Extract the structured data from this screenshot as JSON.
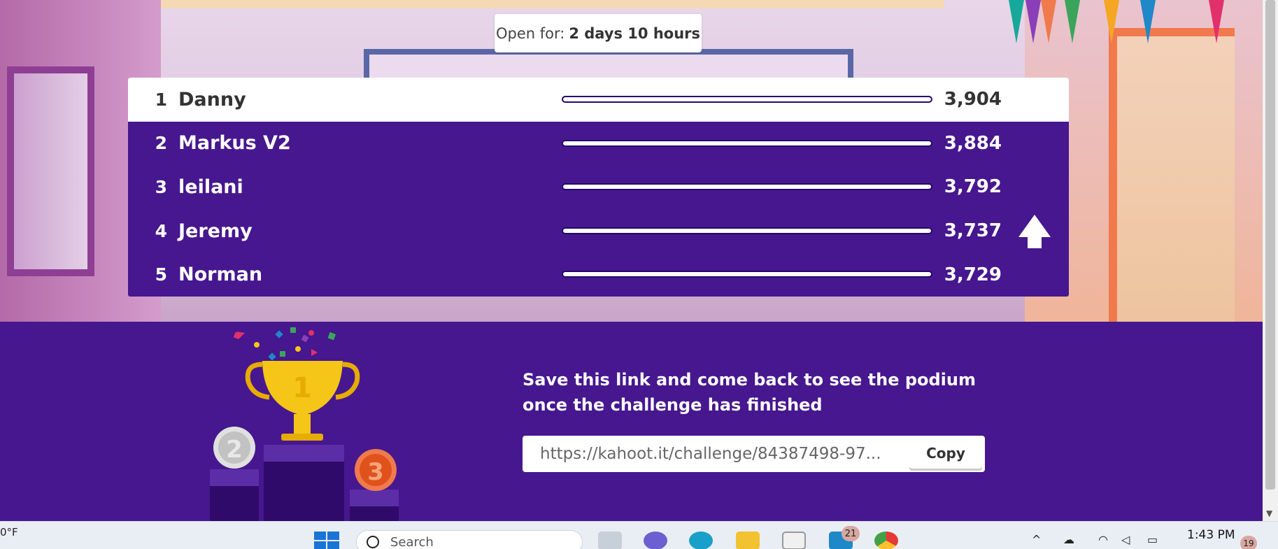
{
  "timer": {
    "label": "Open for:",
    "value": "2 days 10 hours"
  },
  "leaderboard": [
    {
      "rank": "1",
      "name": "Danny",
      "score": "3,904"
    },
    {
      "rank": "2",
      "name": "Markus V2",
      "score": "3,884"
    },
    {
      "rank": "3",
      "name": "leilani",
      "score": "3,792"
    },
    {
      "rank": "4",
      "name": "Jeremy",
      "score": "3,737"
    },
    {
      "rank": "5",
      "name": "Norman",
      "score": "3,729"
    }
  ],
  "share": {
    "message": "Save this link and come back to see the podium once the challenge has finished",
    "link": "https://kahoot.it/challenge/84387498-97...",
    "copy_label": "Copy"
  },
  "podium": {
    "first": "1",
    "second": "2",
    "third": "3"
  },
  "taskbar": {
    "weather": "0°F",
    "search_placeholder": "Search",
    "mail_badge": "21",
    "time": "1:43 PM",
    "notifications": "19"
  },
  "colors": {
    "brand_purple": "#46178f",
    "white": "#ffffff",
    "gold": "#f5c518"
  }
}
